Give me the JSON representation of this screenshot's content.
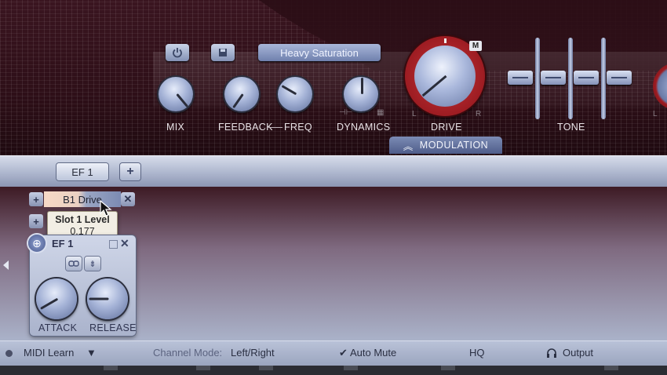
{
  "top": {
    "preset_name": "Heavy Saturation",
    "knobs": {
      "mix": "MIX",
      "feedback": "FEEDBACK",
      "freq": "FREQ",
      "dynamics": "DYNAMICS",
      "drive": "DRIVE",
      "tone": "TONE"
    },
    "drive_badge": "M",
    "drive_l": "L",
    "drive_r": "R",
    "edge_l": "L",
    "modulation": "MODULATION"
  },
  "fx_bar": {
    "tab_label": "EF 1",
    "add_label": "+"
  },
  "slot": {
    "add_label": "+",
    "name": "B1 Drive",
    "close_label": "✕",
    "add2_label": "+"
  },
  "tooltip": {
    "title": "Slot 1 Level",
    "value": "0.177"
  },
  "ef_panel": {
    "title": "EF 1",
    "close_label": "✕",
    "attack": "ATTACK",
    "release": "RELEASE"
  },
  "bottom": {
    "midi_learn": "MIDI Learn",
    "channel_mode_label": "Channel Mode:",
    "channel_mode_value": "Left/Right",
    "auto_mute": "Auto Mute",
    "hq": "HQ",
    "output": "Output"
  }
}
